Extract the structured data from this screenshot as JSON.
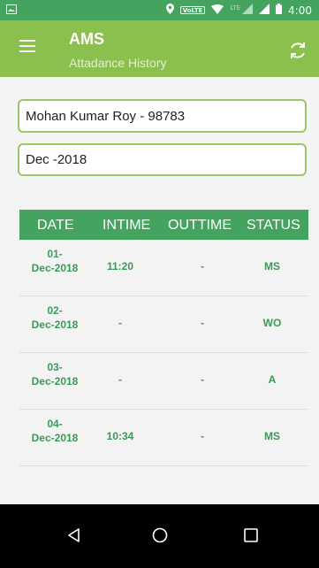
{
  "status_bar": {
    "time": "4:00",
    "network_badge": "VoLTE",
    "lte": "LTE"
  },
  "app_bar": {
    "title": "AMS",
    "subtitle": "Attadance History"
  },
  "form": {
    "employee_value": "Mohan Kumar Roy - 98783",
    "month_value": "Dec -2018"
  },
  "table": {
    "headers": [
      "DATE",
      "INTIME",
      "OUTTIME",
      "STATUS"
    ],
    "rows": [
      {
        "date_day": "01-",
        "date_month": "Dec-2018",
        "intime": "11:20",
        "outtime": "-",
        "status": "MS"
      },
      {
        "date_day": "02-",
        "date_month": "Dec-2018",
        "intime": "-",
        "outtime": "-",
        "status": "WO"
      },
      {
        "date_day": "03-",
        "date_month": "Dec-2018",
        "intime": "-",
        "outtime": "-",
        "status": "A"
      },
      {
        "date_day": "04-",
        "date_month": "Dec-2018",
        "intime": "10:34",
        "outtime": "-",
        "status": "MS"
      }
    ]
  },
  "colors": {
    "primary": "#43a35f",
    "accent": "#8bbf4e",
    "field_border": "#9cc764"
  },
  "icons": [
    "image-icon",
    "location-icon",
    "wifi-icon",
    "signal-icon",
    "battery-icon",
    "menu-icon",
    "refresh-icon",
    "back-icon",
    "home-icon",
    "recents-icon"
  ]
}
